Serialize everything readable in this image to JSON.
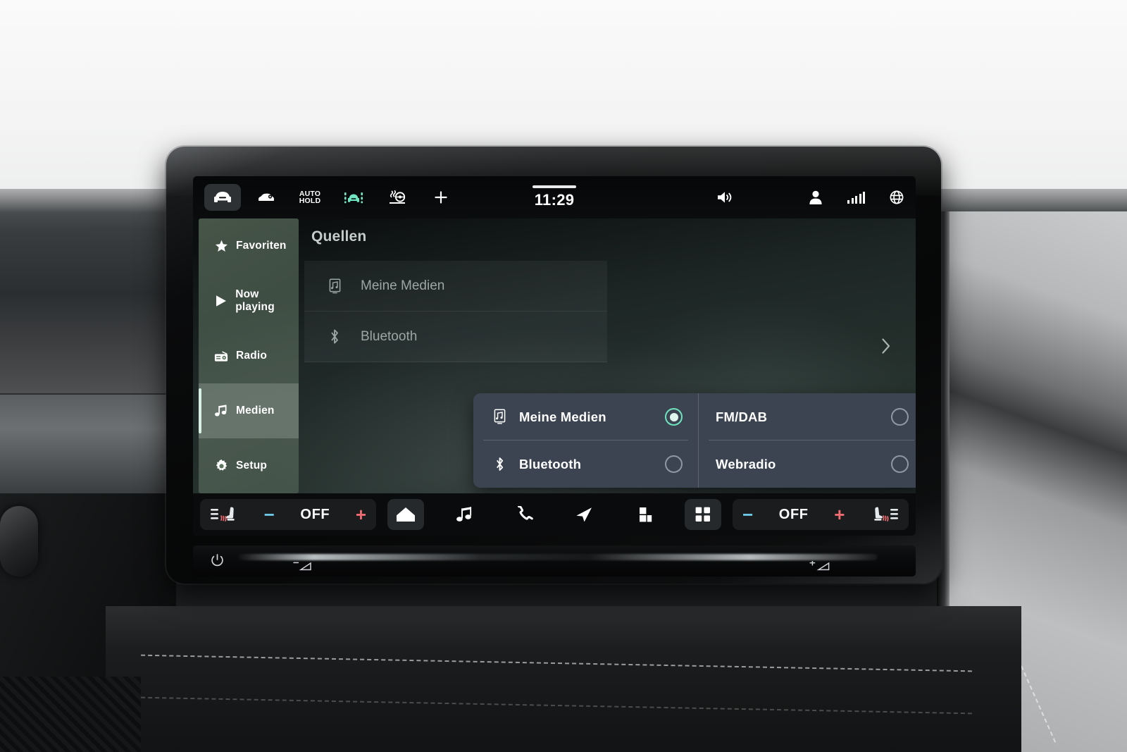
{
  "status_bar": {
    "clock": "11:29",
    "left_icons": [
      {
        "name": "car-front-icon",
        "label": "",
        "active": true
      },
      {
        "name": "car-side-icon",
        "label": "",
        "active": false
      },
      {
        "name": "auto-hold-icon",
        "label": "AUTO HOLD",
        "active": false
      },
      {
        "name": "lane-assist-icon",
        "label": "",
        "active": false
      },
      {
        "name": "heated-steering-wheel-icon",
        "label": "",
        "active": false
      },
      {
        "name": "add-icon",
        "label": "+",
        "active": false
      }
    ],
    "right_icons": [
      {
        "name": "volume-icon"
      },
      {
        "name": "user-profile-icon"
      },
      {
        "name": "signal-bars-icon"
      },
      {
        "name": "globe-icon"
      }
    ]
  },
  "sidebar": {
    "items": [
      {
        "label": "Favoriten",
        "icon": "star-icon",
        "selected": false
      },
      {
        "label": "Now playing",
        "icon": "play-icon",
        "selected": false
      },
      {
        "label": "Radio",
        "icon": "radio-icon",
        "selected": false
      },
      {
        "label": "Medien",
        "icon": "music-note-icon",
        "selected": true
      },
      {
        "label": "Setup",
        "icon": "gear-icon",
        "selected": false
      }
    ]
  },
  "content": {
    "title": "Quellen",
    "sources": [
      {
        "label": "Meine Medien",
        "icon": "media-device-icon"
      },
      {
        "label": "Bluetooth",
        "icon": "bluetooth-icon"
      }
    ]
  },
  "popup": {
    "options": [
      {
        "label": "Meine Medien",
        "icon": "media-device-icon",
        "selected": true
      },
      {
        "label": "FM/DAB",
        "icon": "",
        "selected": false
      },
      {
        "label": "Bluetooth",
        "icon": "bluetooth-icon",
        "selected": false
      },
      {
        "label": "Webradio",
        "icon": "",
        "selected": false
      }
    ]
  },
  "toolbar": {
    "left_climate": {
      "seat_icon": "seat-heating-left-icon",
      "minus": "−",
      "value": "OFF",
      "plus": "+"
    },
    "right_climate": {
      "seat_icon": "seat-heating-right-icon",
      "minus": "−",
      "value": "OFF",
      "plus": "+"
    },
    "center_buttons": [
      {
        "name": "home-button",
        "icon": "home-icon",
        "highlighted": false
      },
      {
        "name": "media-button",
        "icon": "music-note-icon",
        "highlighted": false
      },
      {
        "name": "phone-button",
        "icon": "phone-icon",
        "highlighted": false
      },
      {
        "name": "navigation-button",
        "icon": "navigation-arrow-icon",
        "highlighted": false
      },
      {
        "name": "apps-button",
        "icon": "tiles-icon",
        "highlighted": false
      },
      {
        "name": "all-apps-button",
        "icon": "grid-icon",
        "highlighted": true
      }
    ]
  },
  "hardware_strip": {
    "power": "power-icon",
    "volume_down": "volume-down-icon",
    "volume_up": "volume-up-icon"
  },
  "colors": {
    "accent_teal": "#6fe3bd",
    "popup_bg": "#3b4450",
    "screen_bg": "#27332f",
    "minus_blue": "#6ec8e8",
    "plus_red": "#ef6b72"
  }
}
